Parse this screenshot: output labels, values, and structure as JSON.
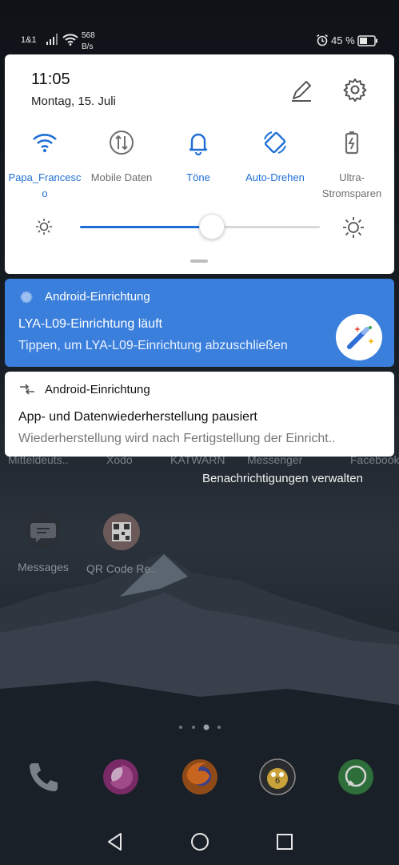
{
  "status_bar": {
    "carrier": "1&1",
    "data_speed_value": "568",
    "data_speed_unit": "B/s",
    "battery_percent": "45 %",
    "icons": [
      "signal-icon",
      "wifi-icon",
      "alarm-icon",
      "battery-icon"
    ]
  },
  "quick_settings": {
    "time": "11:05",
    "date": "Montag, 15. Juli",
    "tiles": [
      {
        "label": "Papa_Francesco",
        "icon": "wifi-icon",
        "active": true
      },
      {
        "label": "Mobile Daten",
        "icon": "mobile-data-icon",
        "active": false
      },
      {
        "label": "Töne",
        "icon": "bell-icon",
        "active": true
      },
      {
        "label": "Auto-Drehen",
        "icon": "auto-rotate-icon",
        "active": true
      },
      {
        "label": "Ultra-Stromsparen",
        "icon": "battery-saver-icon",
        "active": false
      }
    ],
    "brightness_fraction": 0.55,
    "accent_color": "#1f6fd6"
  },
  "notifications": [
    {
      "app": "Android-Einrichtung",
      "title": "LYA-L09-Einrichtung läuft",
      "text": "Tippen, um LYA-L09-Einrichtung abzuschließen",
      "background": "#3a7fdc"
    },
    {
      "app": "Android-Einrichtung",
      "title": "App- und Datenwiederherstellung pausiert",
      "text": "Wiederherstellung wird nach Fertigstellung der Einricht..",
      "background": "#ffffff"
    }
  ],
  "manage_notifications": "Benachrichtigungen verwalten",
  "home_screen": {
    "partial_labels": [
      "Mitteldeuts..",
      "Xodo",
      "KATWARN",
      "Messenger",
      "Facebook"
    ],
    "apps": [
      {
        "label": "Messages",
        "icon": "messages-icon"
      },
      {
        "label": "QR Code Re..",
        "icon": "qr-code-icon"
      }
    ],
    "dock": [
      "phone-icon",
      "firefox-focus-icon",
      "firefox-icon",
      "six-game-icon",
      "whatsapp-icon"
    ]
  },
  "navigation": [
    "back-icon",
    "home-icon",
    "recents-icon"
  ]
}
